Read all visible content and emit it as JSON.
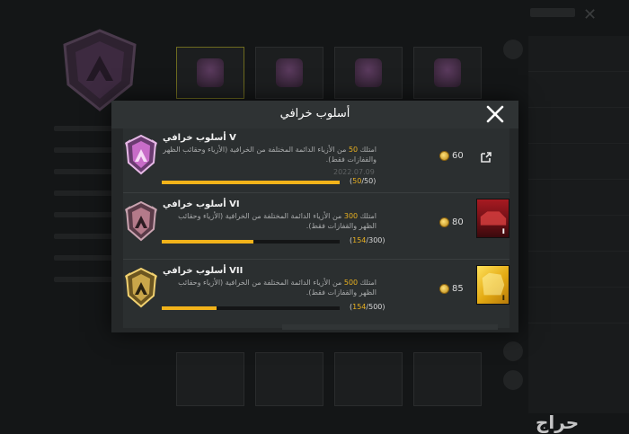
{
  "background": {
    "watermark": "حراج"
  },
  "modal": {
    "title": "أسلوب خرافي",
    "close_icon": "close-icon",
    "rows": [
      {
        "name": "أسلوب خرافي V",
        "desc_prefix": "امتلك ",
        "desc_highlight": "50",
        "desc_suffix": " من الأزياء الدائمة المختلفة من الخرافية (الأزياء وحقائب الظهر والقفازات فقط).",
        "date": "2022.07.09",
        "current": "50",
        "total": "/50)",
        "open_paren": "(",
        "progress": 1.0,
        "reward": "60",
        "badge_color": "#c86cc8",
        "reward_kind": "link-icon"
      },
      {
        "name": "أسلوب خرافي VI",
        "desc_prefix": "امتلك ",
        "desc_highlight": "300",
        "desc_suffix": " من الأزياء الدائمة المختلفة من الخرافية (الأزياء وحقائب الظهر والقفازات فقط).",
        "date": "",
        "current": "154",
        "total": "/300)",
        "open_paren": "(",
        "progress": 0.513,
        "reward": "80",
        "badge_color": "#b47a8a",
        "reward_kind": "red-frame-thumbnail"
      },
      {
        "name": "أسلوب خرافي VII",
        "desc_prefix": "امتلك ",
        "desc_highlight": "500",
        "desc_suffix": " من الأزياء الدائمة المختلفة من الخرافية (الأزياء وحقائب الظهر والقفازات فقط).",
        "date": "",
        "current": "154",
        "total": "/500)",
        "open_paren": "(",
        "progress": 0.308,
        "reward": "85",
        "badge_color": "#c9a64a",
        "reward_kind": "gold-frame-thumbnail"
      }
    ]
  },
  "colors": {
    "accent": "#f2b31a",
    "panel": "#2b2f30",
    "header": "#2f3334"
  }
}
